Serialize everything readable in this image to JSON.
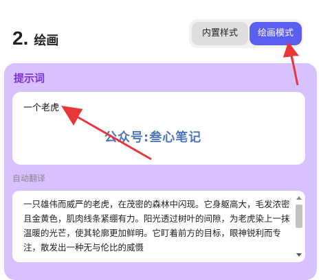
{
  "section": {
    "number": "2.",
    "title": "绘画"
  },
  "mode_toggle": {
    "builtin_label": "内置样式",
    "drawing_label": "绘画模式",
    "active": "drawing"
  },
  "prompt": {
    "label": "提示词",
    "value": "一个老虎"
  },
  "watermark": "公众号:叁心笔记",
  "translation": {
    "label": "自动翻译",
    "text": "一只雄伟而威严的老虎，在茂密的森林中闪现。它身躯高大，毛发浓密且金黄色，肌肉线条紧绷有力。阳光透过树叶的间隙，为老虎染上一抹温暖的光芒，使其轮廓更加鲜明。它盯着前方的目标，眼神锐利而专注，散发出一种无与伦比的威慑"
  },
  "colors": {
    "accent": "#5b5ff0",
    "panel_bg": "#d7c1ff",
    "label_purple": "#7b2fd9",
    "annotation_arrow": "#e8363a"
  }
}
